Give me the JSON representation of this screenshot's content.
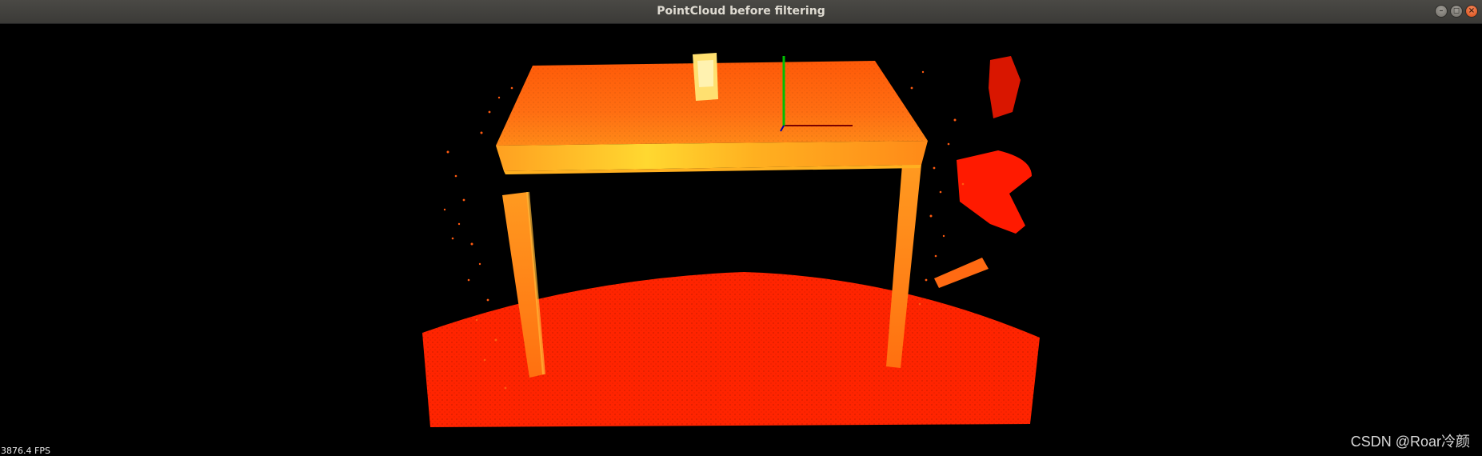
{
  "window": {
    "title": "PointCloud before filtering",
    "controls": {
      "minimize": "–",
      "maximize": "◻",
      "close": "×"
    }
  },
  "viewer": {
    "background": "#000000",
    "fps_label": "3876.4 FPS",
    "axes_colors": {
      "x": "#8b0000",
      "y": "#00c000",
      "z": "#0000aa"
    },
    "cloud_colors": {
      "floor": "#ff2a00",
      "table": "#ff6a10",
      "highlight": "#ffd020"
    }
  },
  "watermark": "CSDN @Roar冷颜"
}
